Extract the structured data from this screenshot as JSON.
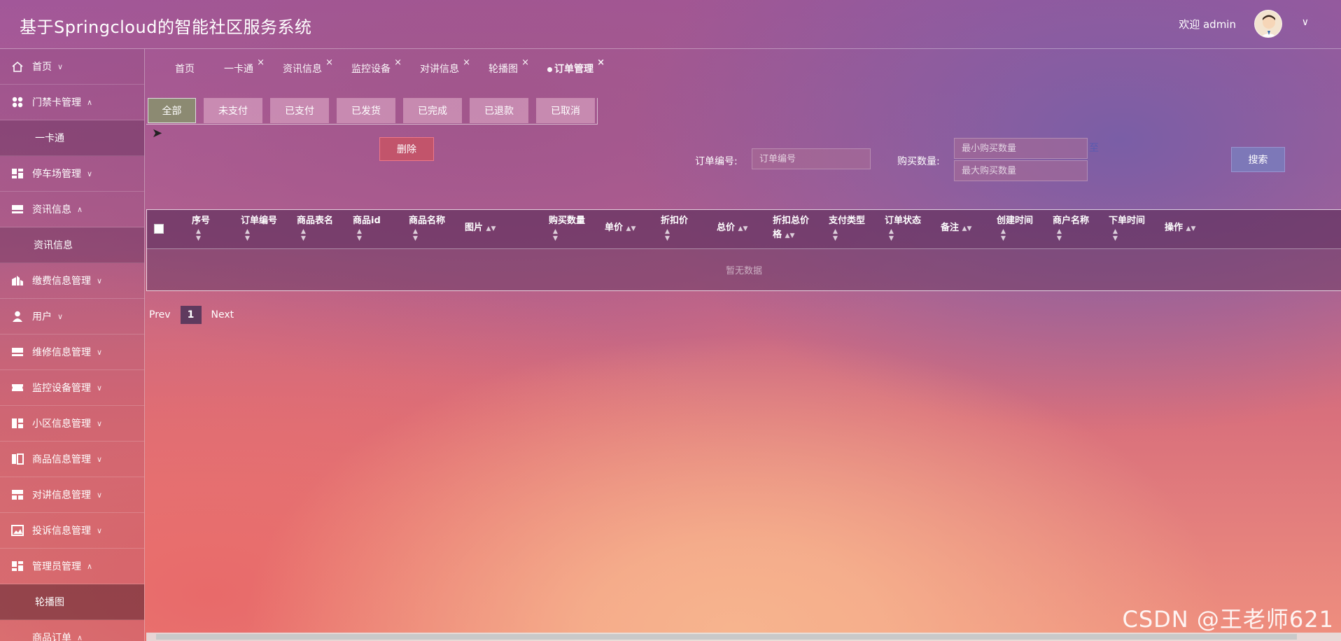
{
  "app": {
    "title": "基于Springcloud的智能社区服务系统"
  },
  "user": {
    "welcome": "欢迎 admin"
  },
  "sidebar": {
    "items": [
      {
        "label": "首页",
        "chevron": "∨"
      },
      {
        "label": "门禁卡管理",
        "chevron": "∧",
        "sub": "一卡通"
      },
      {
        "label": "停车场管理",
        "chevron": "∨"
      },
      {
        "label": "资讯信息",
        "chevron": "∧",
        "sub": "资讯信息"
      },
      {
        "label": "缴费信息管理",
        "chevron": "∨"
      },
      {
        "label": "用户",
        "chevron": "∨"
      },
      {
        "label": "维修信息管理",
        "chevron": "∨"
      },
      {
        "label": "监控设备管理",
        "chevron": "∨"
      },
      {
        "label": "小区信息管理",
        "chevron": "∨"
      },
      {
        "label": "商品信息管理",
        "chevron": "∨"
      },
      {
        "label": "对讲信息管理",
        "chevron": "∨"
      },
      {
        "label": "投诉信息管理",
        "chevron": "∨"
      },
      {
        "label": "管理员管理",
        "chevron": "∧",
        "sub": "轮播图"
      },
      {
        "label": "商品订单",
        "chevron": "∧"
      }
    ]
  },
  "tabs": [
    {
      "label": "首页"
    },
    {
      "label": "一卡通",
      "close": "×"
    },
    {
      "label": "资讯信息",
      "close": "×"
    },
    {
      "label": "监控设备",
      "close": "×"
    },
    {
      "label": "对讲信息",
      "close": "×"
    },
    {
      "label": "轮播图",
      "close": "×"
    },
    {
      "label": "订单管理",
      "close": "×"
    }
  ],
  "status_filters": [
    "全部",
    "未支付",
    "已支付",
    "已发货",
    "已完成",
    "已退款",
    "已取消"
  ],
  "toolbar": {
    "delete_label": "删除",
    "search_label": "搜索"
  },
  "search": {
    "order_no_label": "订单编号:",
    "order_no_placeholder": "订单编号",
    "qty_label": "购买数量:",
    "qty_min_placeholder": "最小购买数量",
    "qty_max_placeholder": "最大购买数量",
    "range_sep": "至"
  },
  "table": {
    "headers": [
      {
        "l1": "序号"
      },
      {
        "l1": "订单编号"
      },
      {
        "l1": "商品表名"
      },
      {
        "l1": "商品id"
      },
      {
        "l1": "商品名称"
      },
      {
        "l1": "图片"
      },
      {
        "l1": "购买数量"
      },
      {
        "l1": "单价"
      },
      {
        "l1": "折扣价"
      },
      {
        "l1": "总价"
      },
      {
        "l1": "折扣总价",
        "l2": "格"
      },
      {
        "l1": "支付类型"
      },
      {
        "l1": "订单状态"
      },
      {
        "l1": "备注"
      },
      {
        "l1": "创建时间"
      },
      {
        "l1": "商户名称"
      },
      {
        "l1": "下单时间"
      },
      {
        "l1": "操作"
      }
    ],
    "empty_text": "暂无数据"
  },
  "pager": {
    "prev": "Prev",
    "page": "1",
    "next": "Next"
  },
  "watermark": "CSDN @王老师621",
  "colors": {
    "active_filter": "#8c8a72",
    "delete": "#c2546b",
    "search": "#7d78b8"
  }
}
